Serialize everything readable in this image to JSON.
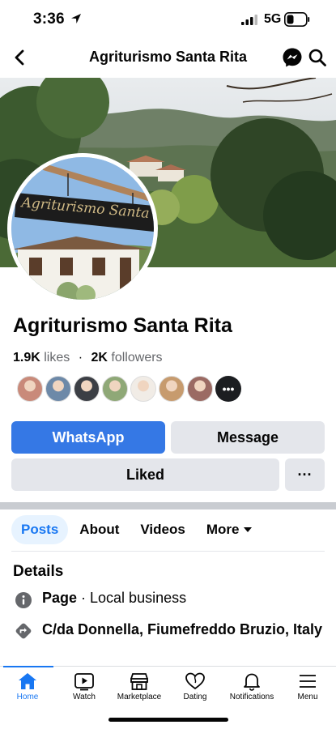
{
  "status": {
    "time": "3:36",
    "network": "5G"
  },
  "header": {
    "title": "Agriturismo Santa Rita"
  },
  "profile": {
    "sign_text": "Agriturismo Santa Rita"
  },
  "page": {
    "name": "Agriturismo Santa Rita",
    "likes_count": "1.9K",
    "likes_label": "likes",
    "separator": "·",
    "followers_count": "2K",
    "followers_label": "followers"
  },
  "friends": {
    "avatar_colors": [
      "#c98a7a",
      "#6d89a8",
      "#3c3f45",
      "#8fa877",
      "#f1ece6",
      "#c79b6e",
      "#9b6a63"
    ],
    "more_label": "•••"
  },
  "actions": {
    "whatsapp": "WhatsApp",
    "message": "Message",
    "liked": "Liked",
    "more": "···"
  },
  "tabs": [
    {
      "label": "Posts",
      "active": true
    },
    {
      "label": "About"
    },
    {
      "label": "Videos"
    },
    {
      "label": "More"
    }
  ],
  "details": {
    "heading": "Details",
    "category_bold": "Page",
    "category_rest": " · Local business",
    "address": "C/da Donnella, Fiumefreddo Bruzio, Italy"
  },
  "tabbar": {
    "items": [
      {
        "label": "Home",
        "icon": "home-icon",
        "active": true
      },
      {
        "label": "Watch",
        "icon": "watch-icon"
      },
      {
        "label": "Marketplace",
        "icon": "marketplace-icon"
      },
      {
        "label": "Dating",
        "icon": "dating-icon"
      },
      {
        "label": "Notifications",
        "icon": "bell-icon"
      },
      {
        "label": "Menu",
        "icon": "menu-icon"
      }
    ]
  },
  "colors": {
    "accent": "#1877f2",
    "whatsapp_button": "#3578e5",
    "button_gray": "#e4e6eb"
  }
}
